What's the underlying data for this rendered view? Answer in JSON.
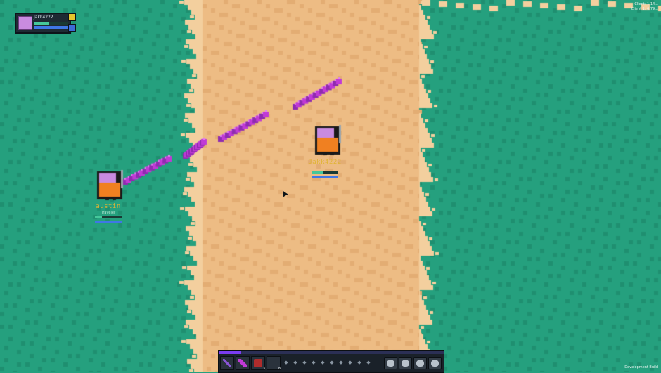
{
  "scene": {
    "grass_color": "#25a07e",
    "grass_dark": "#1f8f70",
    "sand_color": "#edbc84",
    "sand_dark": "#e3ad73",
    "edge_color": "#f3cf9e",
    "projectile_color": "#c13ad6"
  },
  "player_frame": {
    "name": "Jakk4222",
    "hp_fraction": 0.45,
    "mp_fraction": 1.0,
    "portrait_icon": "player-portrait-icon",
    "buttons": [
      {
        "name": "lock-icon",
        "color": "#e7c52c"
      },
      {
        "name": "options-icon",
        "color": "#3c6bd6"
      }
    ]
  },
  "top_right_info": [
    "Client: 1.14...",
    "Client 1: 6.79..."
  ],
  "characters": [
    {
      "id": "main-player",
      "name": "Jakk4222",
      "title": "",
      "body_color": "#f08021",
      "head_color": "#c98be0",
      "hp_fraction": 0.45,
      "mp_fraction": 1.0
    },
    {
      "id": "austin",
      "name": "austin",
      "title": "Traveler",
      "body_color": "#f08021",
      "head_color": "#c98be0",
      "hp_fraction": 0.25,
      "mp_fraction": 1.0
    }
  ],
  "hotbar": {
    "xp_fraction": 0.1,
    "slots": [
      {
        "icon": "purple-sword-icon",
        "count": "",
        "color": "#8a55d8"
      },
      {
        "icon": "magenta-staff-icon",
        "count": "",
        "color": "#c13ad6"
      },
      {
        "icon": "red-tome-icon",
        "count": "3",
        "color": "#b02c2c"
      },
      {
        "icon": "empty-slot-icon",
        "count": "8",
        "color": "#2a323c"
      }
    ],
    "spells": [
      "spell-1-icon",
      "spell-2-icon",
      "spell-3-icon",
      "spell-4-icon",
      "spell-5-icon",
      "spell-6-icon",
      "spell-7-icon",
      "spell-8-icon",
      "spell-9-icon",
      "spell-10-icon"
    ],
    "bags": [
      "bag-1-icon",
      "bag-2-icon",
      "bag-3-icon",
      "bag-4-icon"
    ]
  },
  "dev_build": "Development Build"
}
